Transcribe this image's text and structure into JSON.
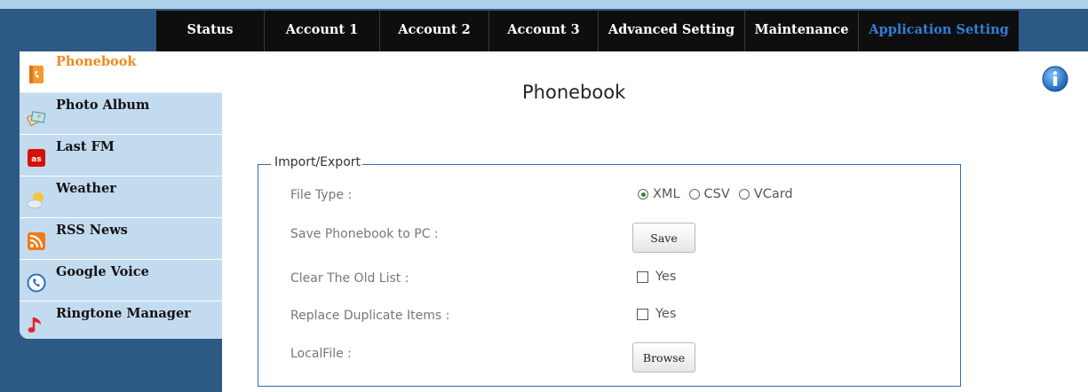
{
  "nav": {
    "tabs": [
      {
        "label": "Status",
        "width": 122
      },
      {
        "label": "Account 1",
        "width": 130
      },
      {
        "label": "Account 2",
        "width": 123
      },
      {
        "label": "Account 3",
        "width": 123
      },
      {
        "label": "Advanced Setting",
        "width": 165
      },
      {
        "label": "Maintenance",
        "width": 128
      },
      {
        "label": "Application Setting",
        "width": 180
      }
    ],
    "active_tab": "Application Setting",
    "active_color": "#2f7fd8"
  },
  "sidebar": {
    "items": [
      {
        "label": "Phonebook",
        "icon": "phonebook-icon"
      },
      {
        "label": "Photo Album",
        "icon": "photo-album-icon"
      },
      {
        "label": "Last FM",
        "icon": "lastfm-icon"
      },
      {
        "label": "Weather",
        "icon": "weather-icon"
      },
      {
        "label": "RSS News",
        "icon": "rss-icon"
      },
      {
        "label": "Google Voice",
        "icon": "google-voice-icon"
      },
      {
        "label": "Ringtone Manager",
        "icon": "ringtone-icon"
      }
    ],
    "active_item": "Phonebook",
    "active_color": "#f08a1c"
  },
  "main": {
    "title": "Phonebook",
    "info_icon": "info-icon",
    "section": {
      "legend": "Import/Export",
      "file_type": {
        "label": "File Type :",
        "options": [
          "XML",
          "CSV",
          "VCard"
        ],
        "selected": "XML"
      },
      "save": {
        "label": "Save Phonebook to PC :",
        "button": "Save"
      },
      "clear_old": {
        "label": "Clear The Old List :",
        "option": "Yes",
        "checked": false
      },
      "replace_dup": {
        "label": "Replace Duplicate Items :",
        "option": "Yes",
        "checked": false
      },
      "local_file": {
        "label": "LocalFile :",
        "button": "Browse"
      }
    }
  },
  "colors": {
    "nav_bg": "#0e0e0e",
    "frame_blue": "#2c5a85",
    "sidebar_bg": "#c3dbef",
    "fieldset_border": "#2f6db0"
  }
}
